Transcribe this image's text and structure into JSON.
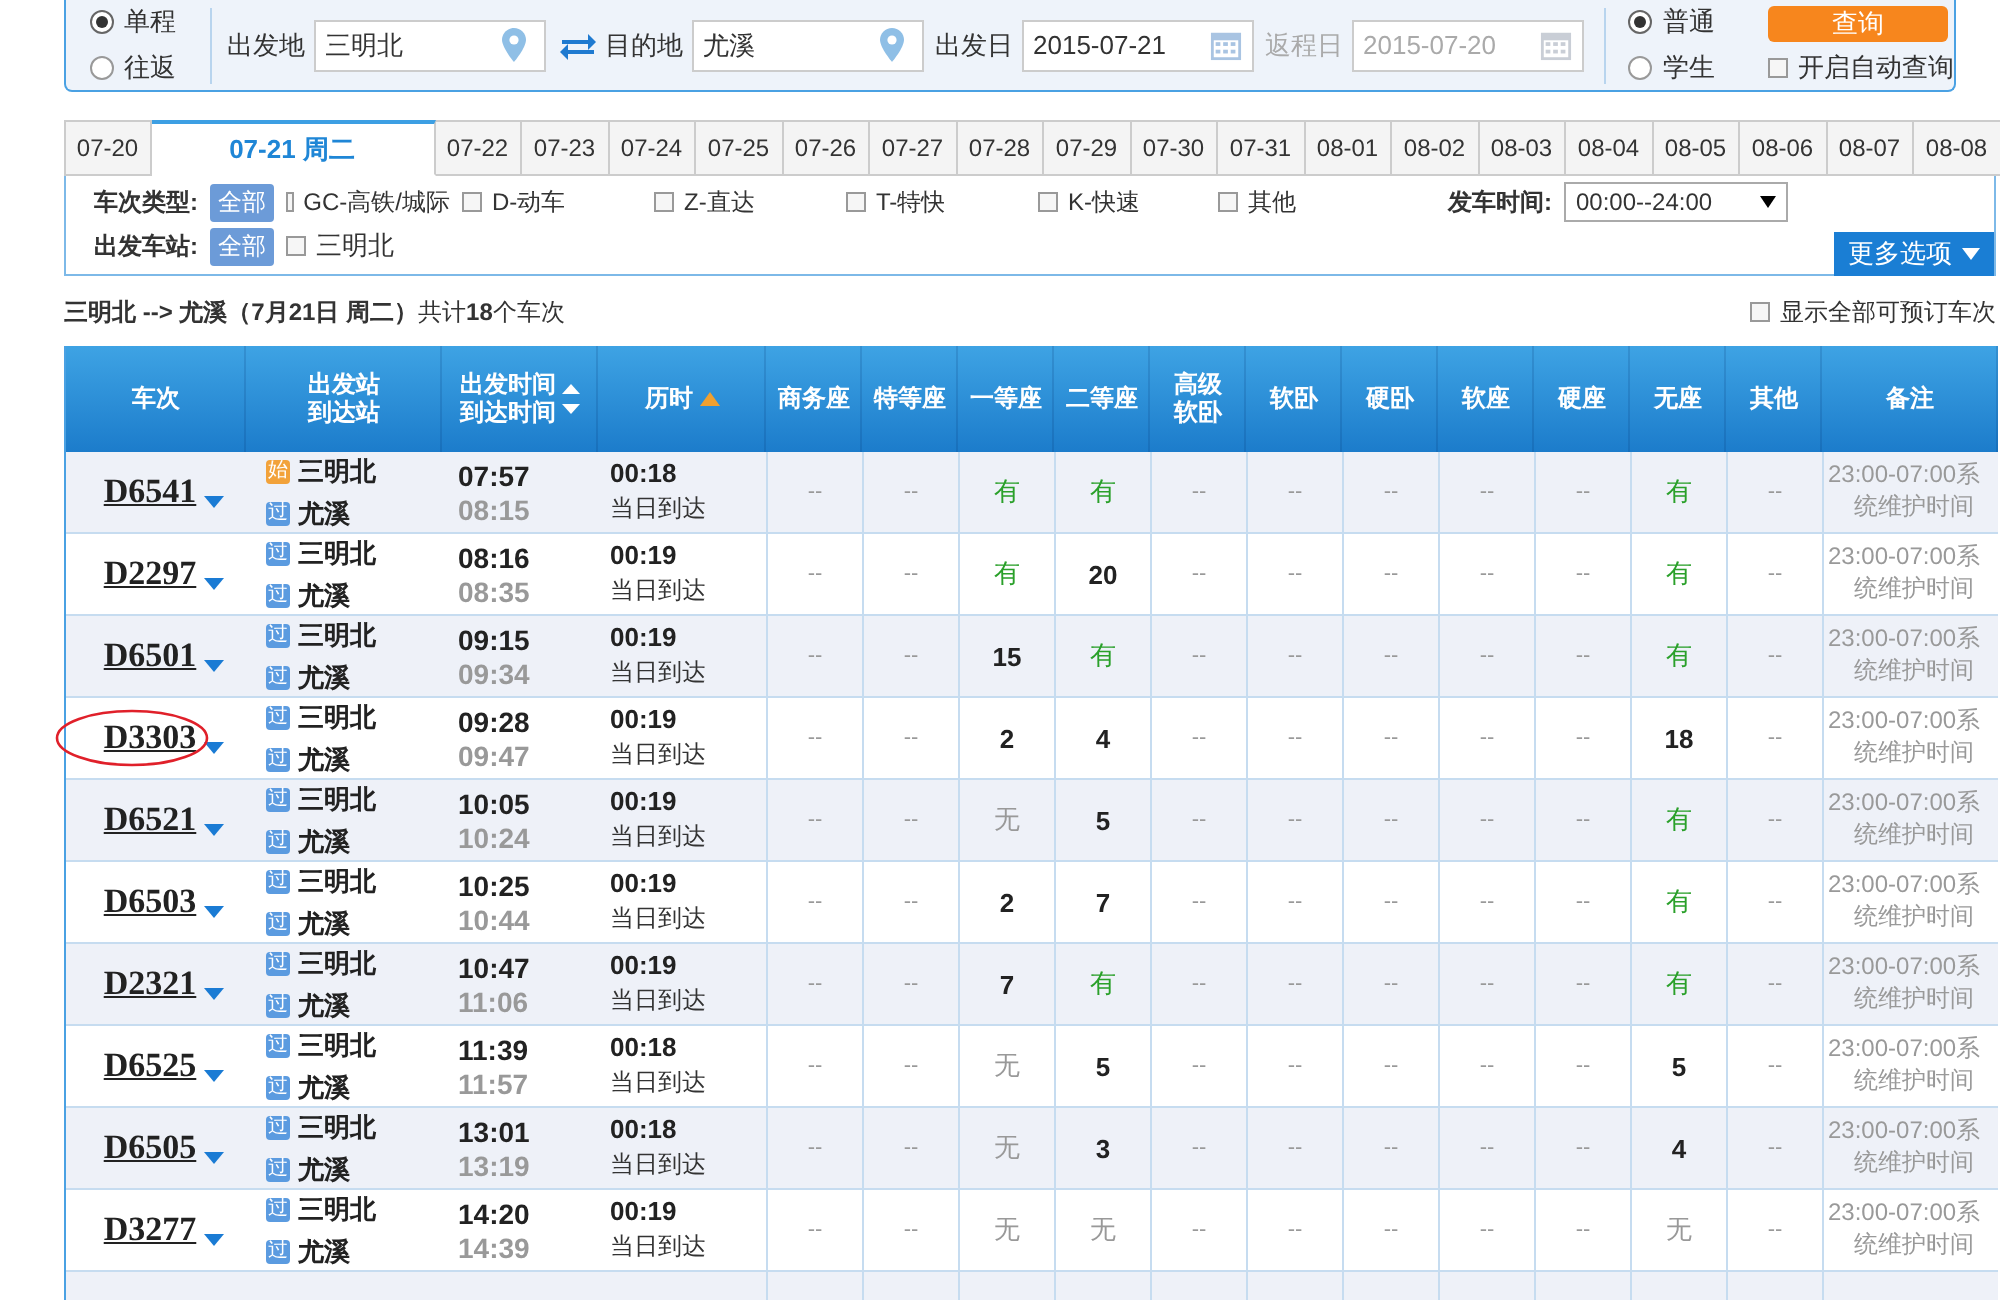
{
  "search": {
    "trip_types": [
      {
        "label": "单程",
        "selected": true
      },
      {
        "label": "往返",
        "selected": false
      }
    ],
    "from": {
      "label": "出发地",
      "value": "三明北"
    },
    "to": {
      "label": "目的地",
      "value": "尤溪"
    },
    "depart_date": {
      "label": "出发日",
      "value": "2015-07-21",
      "disabled": false
    },
    "return_date": {
      "label": "返程日",
      "value": "2015-07-20",
      "disabled": true
    },
    "passenger_types": [
      {
        "label": "普通",
        "selected": true
      },
      {
        "label": "学生",
        "selected": false
      }
    ],
    "query_button": "查询",
    "auto_query": {
      "label": "开启自动查询",
      "checked": false
    }
  },
  "date_tabs": [
    {
      "label": "07-20",
      "selected": false
    },
    {
      "label": "07-21 周二",
      "selected": true
    },
    {
      "label": "07-22",
      "selected": false
    },
    {
      "label": "07-23",
      "selected": false
    },
    {
      "label": "07-24",
      "selected": false
    },
    {
      "label": "07-25",
      "selected": false
    },
    {
      "label": "07-26",
      "selected": false
    },
    {
      "label": "07-27",
      "selected": false
    },
    {
      "label": "07-28",
      "selected": false
    },
    {
      "label": "07-29",
      "selected": false
    },
    {
      "label": "07-30",
      "selected": false
    },
    {
      "label": "07-31",
      "selected": false
    },
    {
      "label": "08-01",
      "selected": false
    },
    {
      "label": "08-02",
      "selected": false
    },
    {
      "label": "08-03",
      "selected": false
    },
    {
      "label": "08-04",
      "selected": false
    },
    {
      "label": "08-05",
      "selected": false
    },
    {
      "label": "08-06",
      "selected": false
    },
    {
      "label": "08-07",
      "selected": false
    },
    {
      "label": "08-08",
      "selected": false
    }
  ],
  "filters": {
    "type_label": "车次类型:",
    "type_all": "全部",
    "types": [
      {
        "label": "GC-高铁/城际",
        "checked": false
      },
      {
        "label": "D-动车",
        "checked": false
      },
      {
        "label": "Z-直达",
        "checked": false
      },
      {
        "label": "T-特快",
        "checked": false
      },
      {
        "label": "K-快速",
        "checked": false
      },
      {
        "label": "其他",
        "checked": false
      }
    ],
    "station_label": "出发车站:",
    "station_all": "全部",
    "stations": [
      {
        "label": "三明北",
        "checked": false
      }
    ],
    "time_label": "发车时间:",
    "time_value": "00:00--24:00",
    "more_button": "更多选项"
  },
  "summary": "**三明北 --> 尤溪（7月21日  周二）**共计**18**个车次",
  "show_all": {
    "label": "显示全部可预订车次",
    "checked": false
  },
  "table": {
    "columns": [
      {
        "label": "车次",
        "kind": "plain"
      },
      {
        "label": "出发站到达站",
        "kind": "plain"
      },
      {
        "label": "出发时间到达时间",
        "kind": "sortable"
      },
      {
        "label": "历时",
        "kind": "sorted"
      },
      {
        "label": "商务座",
        "kind": "plain"
      },
      {
        "label": "特等座",
        "kind": "plain"
      },
      {
        "label": "一等座",
        "kind": "plain"
      },
      {
        "label": "二等座",
        "kind": "plain"
      },
      {
        "label": "高级软卧",
        "kind": "plain"
      },
      {
        "label": "软卧",
        "kind": "plain"
      },
      {
        "label": "硬卧",
        "kind": "plain"
      },
      {
        "label": "软座",
        "kind": "plain"
      },
      {
        "label": "硬座",
        "kind": "plain"
      },
      {
        "label": "无座",
        "kind": "plain"
      },
      {
        "label": "其他",
        "kind": "plain"
      },
      {
        "label": "备注",
        "kind": "plain"
      }
    ],
    "rows": [
      {
        "code": "D6541",
        "circled": false,
        "from": {
          "badge": "始",
          "kind": "start",
          "name": "三明北"
        },
        "to": {
          "badge": "过",
          "kind": "pass",
          "name": "尤溪"
        },
        "depart": "07:57",
        "arrive": "08:15",
        "duration": "00:18",
        "arrival_day": "当日到达",
        "seats": [
          {
            "text": "--",
            "kind": "dash"
          },
          {
            "text": "--",
            "kind": "dash"
          },
          {
            "text": "有",
            "kind": "yes"
          },
          {
            "text": "有",
            "kind": "yes"
          },
          {
            "text": "--",
            "kind": "dash"
          },
          {
            "text": "--",
            "kind": "dash"
          },
          {
            "text": "--",
            "kind": "dash"
          },
          {
            "text": "--",
            "kind": "dash"
          },
          {
            "text": "--",
            "kind": "dash"
          },
          {
            "text": "有",
            "kind": "yes"
          },
          {
            "text": "--",
            "kind": "dash"
          }
        ],
        "note": [
          "23:00-07:00系",
          "统维护时间"
        ]
      },
      {
        "code": "D2297",
        "circled": false,
        "from": {
          "badge": "过",
          "kind": "pass",
          "name": "三明北"
        },
        "to": {
          "badge": "过",
          "kind": "pass",
          "name": "尤溪"
        },
        "depart": "08:16",
        "arrive": "08:35",
        "duration": "00:19",
        "arrival_day": "当日到达",
        "seats": [
          {
            "text": "--",
            "kind": "dash"
          },
          {
            "text": "--",
            "kind": "dash"
          },
          {
            "text": "有",
            "kind": "yes"
          },
          {
            "text": "20",
            "kind": "count"
          },
          {
            "text": "--",
            "kind": "dash"
          },
          {
            "text": "--",
            "kind": "dash"
          },
          {
            "text": "--",
            "kind": "dash"
          },
          {
            "text": "--",
            "kind": "dash"
          },
          {
            "text": "--",
            "kind": "dash"
          },
          {
            "text": "有",
            "kind": "yes"
          },
          {
            "text": "--",
            "kind": "dash"
          }
        ],
        "note": [
          "23:00-07:00系",
          "统维护时间"
        ]
      },
      {
        "code": "D6501",
        "circled": false,
        "from": {
          "badge": "过",
          "kind": "pass",
          "name": "三明北"
        },
        "to": {
          "badge": "过",
          "kind": "pass",
          "name": "尤溪"
        },
        "depart": "09:15",
        "arrive": "09:34",
        "duration": "00:19",
        "arrival_day": "当日到达",
        "seats": [
          {
            "text": "--",
            "kind": "dash"
          },
          {
            "text": "--",
            "kind": "dash"
          },
          {
            "text": "15",
            "kind": "count"
          },
          {
            "text": "有",
            "kind": "yes"
          },
          {
            "text": "--",
            "kind": "dash"
          },
          {
            "text": "--",
            "kind": "dash"
          },
          {
            "text": "--",
            "kind": "dash"
          },
          {
            "text": "--",
            "kind": "dash"
          },
          {
            "text": "--",
            "kind": "dash"
          },
          {
            "text": "有",
            "kind": "yes"
          },
          {
            "text": "--",
            "kind": "dash"
          }
        ],
        "note": [
          "23:00-07:00系",
          "统维护时间"
        ]
      },
      {
        "code": "D3303",
        "circled": true,
        "from": {
          "badge": "过",
          "kind": "pass",
          "name": "三明北"
        },
        "to": {
          "badge": "过",
          "kind": "pass",
          "name": "尤溪"
        },
        "depart": "09:28",
        "arrive": "09:47",
        "duration": "00:19",
        "arrival_day": "当日到达",
        "seats": [
          {
            "text": "--",
            "kind": "dash"
          },
          {
            "text": "--",
            "kind": "dash"
          },
          {
            "text": "2",
            "kind": "count"
          },
          {
            "text": "4",
            "kind": "count"
          },
          {
            "text": "--",
            "kind": "dash"
          },
          {
            "text": "--",
            "kind": "dash"
          },
          {
            "text": "--",
            "kind": "dash"
          },
          {
            "text": "--",
            "kind": "dash"
          },
          {
            "text": "--",
            "kind": "dash"
          },
          {
            "text": "18",
            "kind": "count"
          },
          {
            "text": "--",
            "kind": "dash"
          }
        ],
        "note": [
          "23:00-07:00系",
          "统维护时间"
        ]
      },
      {
        "code": "D6521",
        "circled": false,
        "from": {
          "badge": "过",
          "kind": "pass",
          "name": "三明北"
        },
        "to": {
          "badge": "过",
          "kind": "pass",
          "name": "尤溪"
        },
        "depart": "10:05",
        "arrive": "10:24",
        "duration": "00:19",
        "arrival_day": "当日到达",
        "seats": [
          {
            "text": "--",
            "kind": "dash"
          },
          {
            "text": "--",
            "kind": "dash"
          },
          {
            "text": "无",
            "kind": "none"
          },
          {
            "text": "5",
            "kind": "count"
          },
          {
            "text": "--",
            "kind": "dash"
          },
          {
            "text": "--",
            "kind": "dash"
          },
          {
            "text": "--",
            "kind": "dash"
          },
          {
            "text": "--",
            "kind": "dash"
          },
          {
            "text": "--",
            "kind": "dash"
          },
          {
            "text": "有",
            "kind": "yes"
          },
          {
            "text": "--",
            "kind": "dash"
          }
        ],
        "note": [
          "23:00-07:00系",
          "统维护时间"
        ]
      },
      {
        "code": "D6503",
        "circled": false,
        "from": {
          "badge": "过",
          "kind": "pass",
          "name": "三明北"
        },
        "to": {
          "badge": "过",
          "kind": "pass",
          "name": "尤溪"
        },
        "depart": "10:25",
        "arrive": "10:44",
        "duration": "00:19",
        "arrival_day": "当日到达",
        "seats": [
          {
            "text": "--",
            "kind": "dash"
          },
          {
            "text": "--",
            "kind": "dash"
          },
          {
            "text": "2",
            "kind": "count"
          },
          {
            "text": "7",
            "kind": "count"
          },
          {
            "text": "--",
            "kind": "dash"
          },
          {
            "text": "--",
            "kind": "dash"
          },
          {
            "text": "--",
            "kind": "dash"
          },
          {
            "text": "--",
            "kind": "dash"
          },
          {
            "text": "--",
            "kind": "dash"
          },
          {
            "text": "有",
            "kind": "yes"
          },
          {
            "text": "--",
            "kind": "dash"
          }
        ],
        "note": [
          "23:00-07:00系",
          "统维护时间"
        ]
      },
      {
        "code": "D2321",
        "circled": false,
        "from": {
          "badge": "过",
          "kind": "pass",
          "name": "三明北"
        },
        "to": {
          "badge": "过",
          "kind": "pass",
          "name": "尤溪"
        },
        "depart": "10:47",
        "arrive": "11:06",
        "duration": "00:19",
        "arrival_day": "当日到达",
        "seats": [
          {
            "text": "--",
            "kind": "dash"
          },
          {
            "text": "--",
            "kind": "dash"
          },
          {
            "text": "7",
            "kind": "count"
          },
          {
            "text": "有",
            "kind": "yes"
          },
          {
            "text": "--",
            "kind": "dash"
          },
          {
            "text": "--",
            "kind": "dash"
          },
          {
            "text": "--",
            "kind": "dash"
          },
          {
            "text": "--",
            "kind": "dash"
          },
          {
            "text": "--",
            "kind": "dash"
          },
          {
            "text": "有",
            "kind": "yes"
          },
          {
            "text": "--",
            "kind": "dash"
          }
        ],
        "note": [
          "23:00-07:00系",
          "统维护时间"
        ]
      },
      {
        "code": "D6525",
        "circled": false,
        "from": {
          "badge": "过",
          "kind": "pass",
          "name": "三明北"
        },
        "to": {
          "badge": "过",
          "kind": "pass",
          "name": "尤溪"
        },
        "depart": "11:39",
        "arrive": "11:57",
        "duration": "00:18",
        "arrival_day": "当日到达",
        "seats": [
          {
            "text": "--",
            "kind": "dash"
          },
          {
            "text": "--",
            "kind": "dash"
          },
          {
            "text": "无",
            "kind": "none"
          },
          {
            "text": "5",
            "kind": "count"
          },
          {
            "text": "--",
            "kind": "dash"
          },
          {
            "text": "--",
            "kind": "dash"
          },
          {
            "text": "--",
            "kind": "dash"
          },
          {
            "text": "--",
            "kind": "dash"
          },
          {
            "text": "--",
            "kind": "dash"
          },
          {
            "text": "5",
            "kind": "count"
          },
          {
            "text": "--",
            "kind": "dash"
          }
        ],
        "note": [
          "23:00-07:00系",
          "统维护时间"
        ]
      },
      {
        "code": "D6505",
        "circled": false,
        "from": {
          "badge": "过",
          "kind": "pass",
          "name": "三明北"
        },
        "to": {
          "badge": "过",
          "kind": "pass",
          "name": "尤溪"
        },
        "depart": "13:01",
        "arrive": "13:19",
        "duration": "00:18",
        "arrival_day": "当日到达",
        "seats": [
          {
            "text": "--",
            "kind": "dash"
          },
          {
            "text": "--",
            "kind": "dash"
          },
          {
            "text": "无",
            "kind": "none"
          },
          {
            "text": "3",
            "kind": "count"
          },
          {
            "text": "--",
            "kind": "dash"
          },
          {
            "text": "--",
            "kind": "dash"
          },
          {
            "text": "--",
            "kind": "dash"
          },
          {
            "text": "--",
            "kind": "dash"
          },
          {
            "text": "--",
            "kind": "dash"
          },
          {
            "text": "4",
            "kind": "count"
          },
          {
            "text": "--",
            "kind": "dash"
          }
        ],
        "note": [
          "23:00-07:00系",
          "统维护时间"
        ]
      },
      {
        "code": "D3277",
        "circled": false,
        "from": {
          "badge": "过",
          "kind": "pass",
          "name": "三明北"
        },
        "to": {
          "badge": "过",
          "kind": "pass",
          "name": "尤溪"
        },
        "depart": "14:20",
        "arrive": "14:39",
        "duration": "00:19",
        "arrival_day": "当日到达",
        "seats": [
          {
            "text": "--",
            "kind": "dash"
          },
          {
            "text": "--",
            "kind": "dash"
          },
          {
            "text": "无",
            "kind": "none"
          },
          {
            "text": "无",
            "kind": "none"
          },
          {
            "text": "--",
            "kind": "dash"
          },
          {
            "text": "--",
            "kind": "dash"
          },
          {
            "text": "--",
            "kind": "dash"
          },
          {
            "text": "--",
            "kind": "dash"
          },
          {
            "text": "--",
            "kind": "dash"
          },
          {
            "text": "无",
            "kind": "none"
          },
          {
            "text": "--",
            "kind": "dash"
          }
        ],
        "note": [
          "23:00-07:00系",
          "统维护时间"
        ]
      }
    ]
  }
}
